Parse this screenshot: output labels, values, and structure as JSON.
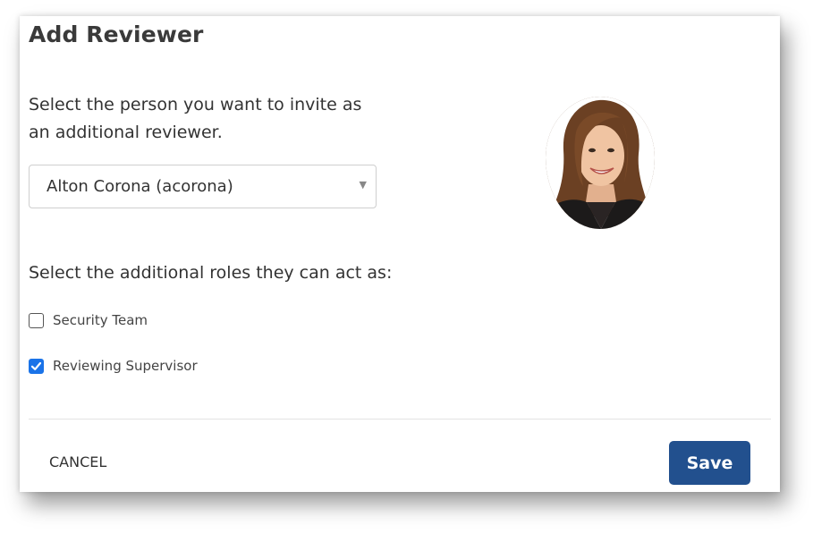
{
  "dialog": {
    "title": "Add Reviewer",
    "person_prompt": "Select the person you want to invite as an additional reviewer.",
    "person_select": {
      "selected": "Alton Corona (acorona)"
    },
    "avatar_icon": "person-photo",
    "roles_prompt": "Select the additional roles they can act as:",
    "roles": [
      {
        "label": "Security Team",
        "checked": false
      },
      {
        "label": "Reviewing Supervisor",
        "checked": true
      }
    ],
    "cancel_label": "CANCEL",
    "save_label": "Save"
  },
  "colors": {
    "primary_button": "#22508e",
    "checkbox_checked": "#1a73e8"
  }
}
